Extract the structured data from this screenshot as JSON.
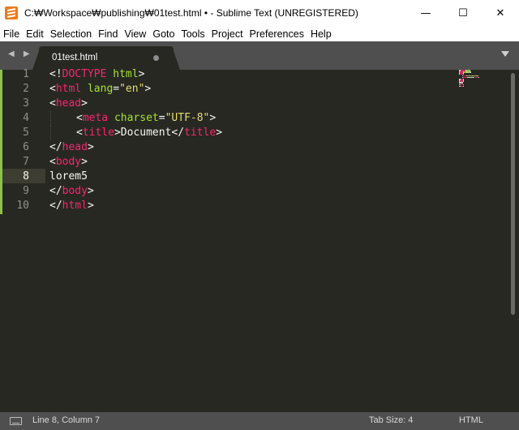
{
  "window": {
    "title": "C:₩Workspace₩publishing₩01test.html • - Sublime Text (UNREGISTERED)",
    "minimize": "—",
    "maximize": "☐",
    "close": "✕"
  },
  "menu": {
    "items": [
      "File",
      "Edit",
      "Selection",
      "Find",
      "View",
      "Goto",
      "Tools",
      "Project",
      "Preferences",
      "Help"
    ]
  },
  "tabs": {
    "nav": "◀ ▶",
    "active_tab": "01test.html"
  },
  "editor": {
    "line_numbers": [
      "1",
      "2",
      "3",
      "4",
      "5",
      "6",
      "7",
      "8",
      "9",
      "10"
    ],
    "current_line": "8",
    "lines": [
      [
        [
          "<!",
          "t-p"
        ],
        [
          "DOCTYPE",
          "t-tag"
        ],
        [
          " ",
          "t-p"
        ],
        [
          "html",
          "t-attr"
        ],
        [
          ">",
          "t-p"
        ]
      ],
      [
        [
          "<",
          "t-p"
        ],
        [
          "html",
          "t-tag"
        ],
        [
          " ",
          "t-p"
        ],
        [
          "lang",
          "t-attr"
        ],
        [
          "=",
          "t-p"
        ],
        [
          "\"en\"",
          "t-str"
        ],
        [
          ">",
          "t-p"
        ]
      ],
      [
        [
          "<",
          "t-p"
        ],
        [
          "head",
          "t-tag"
        ],
        [
          ">",
          "t-p"
        ]
      ],
      [
        [
          "INDENT",
          ""
        ],
        [
          "<",
          "t-p"
        ],
        [
          "meta",
          "t-tag"
        ],
        [
          " ",
          "t-p"
        ],
        [
          "charset",
          "t-attr"
        ],
        [
          "=",
          "t-p"
        ],
        [
          "\"UTF-8\"",
          "t-str"
        ],
        [
          ">",
          "t-p"
        ]
      ],
      [
        [
          "INDENT",
          ""
        ],
        [
          "<",
          "t-p"
        ],
        [
          "title",
          "t-tag"
        ],
        [
          ">",
          "t-p"
        ],
        [
          "Document",
          "t-p"
        ],
        [
          "</",
          "t-p"
        ],
        [
          "title",
          "t-tag"
        ],
        [
          ">",
          "t-p"
        ]
      ],
      [
        [
          "</",
          "t-p"
        ],
        [
          "head",
          "t-tag"
        ],
        [
          ">",
          "t-p"
        ]
      ],
      [
        [
          "<",
          "t-p"
        ],
        [
          "body",
          "t-tag"
        ],
        [
          ">",
          "t-p"
        ]
      ],
      [
        [
          "lorem5",
          "t-p"
        ]
      ],
      [
        [
          "</",
          "t-p"
        ],
        [
          "body",
          "t-tag"
        ],
        [
          ">",
          "t-p"
        ]
      ],
      [
        [
          "</",
          "t-p"
        ],
        [
          "html",
          "t-tag"
        ],
        [
          ">",
          "t-p"
        ]
      ]
    ]
  },
  "status": {
    "position": "Line 8, Column 7",
    "tab_size": "Tab Size: 4",
    "syntax": "HTML"
  },
  "colors": {
    "editor_bg": "#272822",
    "tag": "#f92672",
    "attr": "#a6e22e",
    "string": "#e6db74",
    "text": "#f8f8f2",
    "chrome": "#4f4f4f",
    "diff_added": "#8bc34a"
  },
  "icons": {
    "app": "sublime-text-icon",
    "console": "console-panel-icon",
    "dirty": "unsaved-dot-icon",
    "tab_menu": "triangle-down-icon"
  }
}
